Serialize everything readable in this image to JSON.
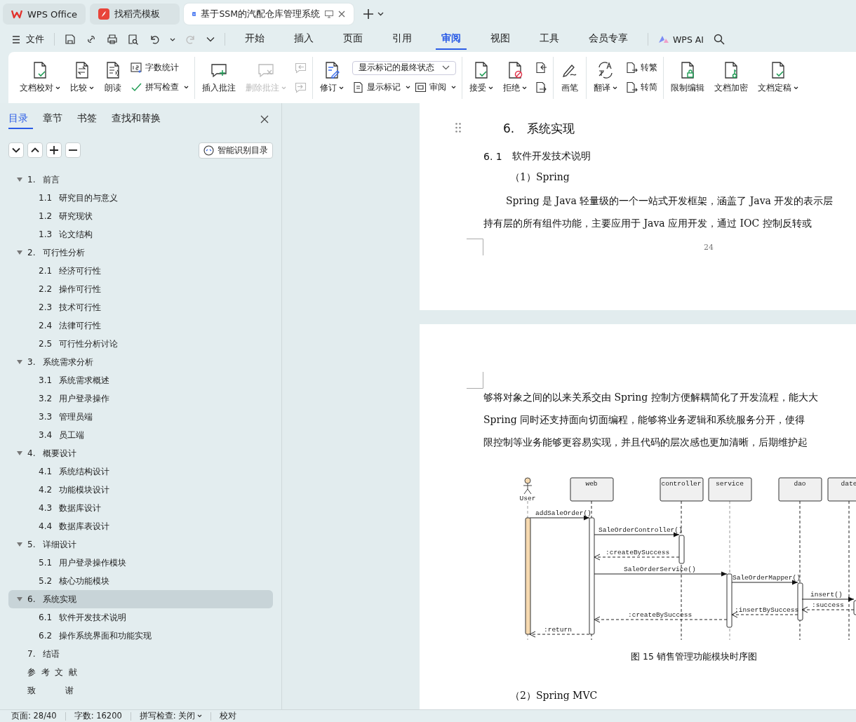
{
  "tabs": [
    {
      "label": "WPS Office",
      "kind": "home",
      "selected": false
    },
    {
      "label": "找稻壳模板",
      "kind": "template",
      "selected": false
    },
    {
      "label": "基于SSM的汽配仓库管理系统",
      "kind": "document",
      "selected": true
    }
  ],
  "menu": {
    "file_label": "文件",
    "items": [
      {
        "label": "开始",
        "selected": false
      },
      {
        "label": "插入",
        "selected": false
      },
      {
        "label": "页面",
        "selected": false
      },
      {
        "label": "引用",
        "selected": false
      },
      {
        "label": "审阅",
        "selected": true
      },
      {
        "label": "视图",
        "selected": false
      },
      {
        "label": "工具",
        "selected": false
      },
      {
        "label": "会员专享",
        "selected": false
      }
    ],
    "ai_label": "WPS AI"
  },
  "ribbon": {
    "groups": [
      {
        "tools": [
          {
            "kind": "large",
            "label": "文档校对",
            "dropdown": true,
            "disabled": false
          },
          {
            "kind": "large",
            "label": "比较",
            "dropdown": true,
            "disabled": false
          },
          {
            "kind": "large",
            "label": "朗读",
            "dropdown": false,
            "disabled": false
          },
          {
            "kind": "stack",
            "items": [
              {
                "kind": "small",
                "label": "字数统计",
                "dropdown": false,
                "disabled": false
              },
              {
                "kind": "small",
                "label": "拼写检查",
                "dropdown": true,
                "disabled": false
              }
            ]
          }
        ]
      },
      {
        "tools": [
          {
            "kind": "large",
            "label": "插入批注",
            "dropdown": false,
            "disabled": false
          },
          {
            "kind": "large",
            "label": "删除批注",
            "dropdown": true,
            "disabled": true
          },
          {
            "kind": "stack",
            "items": [
              {
                "kind": "icon",
                "disabled": true
              },
              {
                "kind": "icon",
                "disabled": true
              }
            ]
          }
        ]
      },
      {
        "tools": [
          {
            "kind": "large",
            "label": "修订",
            "dropdown": true,
            "disabled": false
          },
          {
            "kind": "stack",
            "items": [
              {
                "kind": "select",
                "value": "显示标记的最终状态"
              },
              {
                "kind": "row",
                "items": [
                  {
                    "kind": "small",
                    "label": "显示标记",
                    "dropdown": true,
                    "disabled": false
                  },
                  {
                    "kind": "small",
                    "label": "审阅",
                    "dropdown": true,
                    "disabled": false
                  }
                ]
              }
            ]
          }
        ]
      },
      {
        "tools": [
          {
            "kind": "large",
            "label": "接受",
            "dropdown": true,
            "disabled": false
          },
          {
            "kind": "large",
            "label": "拒绝",
            "dropdown": true,
            "disabled": false
          },
          {
            "kind": "stack",
            "items": [
              {
                "kind": "icon",
                "disabled": false
              },
              {
                "kind": "icon",
                "disabled": false
              }
            ]
          }
        ]
      },
      {
        "tools": [
          {
            "kind": "large",
            "label": "画笔",
            "dropdown": false,
            "disabled": false
          }
        ]
      },
      {
        "tools": [
          {
            "kind": "large",
            "label": "翻译",
            "dropdown": true,
            "disabled": false
          },
          {
            "kind": "stack",
            "items": [
              {
                "kind": "small",
                "label": "转繁",
                "dropdown": false,
                "disabled": false
              },
              {
                "kind": "small",
                "label": "转简",
                "dropdown": false,
                "disabled": false
              }
            ]
          }
        ]
      },
      {
        "tools": [
          {
            "kind": "large",
            "label": "限制编辑",
            "dropdown": false,
            "disabled": false
          },
          {
            "kind": "large",
            "label": "文档加密",
            "dropdown": false,
            "disabled": false
          },
          {
            "kind": "large",
            "label": "文档定稿",
            "dropdown": true,
            "disabled": false
          }
        ]
      }
    ]
  },
  "sidebar": {
    "tabs": [
      {
        "label": "目录",
        "selected": true
      },
      {
        "label": "章节",
        "selected": false
      },
      {
        "label": "书签",
        "selected": false
      },
      {
        "label": "查找和替换",
        "selected": false
      }
    ],
    "smart_button": "智能识别目录",
    "toc": [
      {
        "number": "1.",
        "title": "前言",
        "expanded": true,
        "selected": false,
        "children": [
          {
            "number": "1.1",
            "title": "研究目的与意义",
            "selected": false
          },
          {
            "number": "1.2",
            "title": "研究现状",
            "selected": false
          },
          {
            "number": "1.3",
            "title": "论文结构",
            "selected": false
          }
        ]
      },
      {
        "number": "2.",
        "title": "可行性分析",
        "expanded": true,
        "selected": false,
        "children": [
          {
            "number": "2.1",
            "title": "经济可行性",
            "selected": false
          },
          {
            "number": "2.2",
            "title": "操作可行性",
            "selected": false
          },
          {
            "number": "2.3",
            "title": "技术可行性",
            "selected": false
          },
          {
            "number": "2.4",
            "title": "法律可行性",
            "selected": false
          },
          {
            "number": "2.5",
            "title": "可行性分析讨论",
            "selected": false
          }
        ]
      },
      {
        "number": "3.",
        "title": "系统需求分析",
        "expanded": true,
        "selected": false,
        "children": [
          {
            "number": "3.1",
            "title": "系统需求概述",
            "selected": false
          },
          {
            "number": "3.2",
            "title": "用户登录操作",
            "selected": false
          },
          {
            "number": "3.3",
            "title": "管理员端",
            "selected": false
          },
          {
            "number": "3.4",
            "title": "员工端",
            "selected": false
          }
        ]
      },
      {
        "number": "4.",
        "title": "概要设计",
        "expanded": true,
        "selected": false,
        "children": [
          {
            "number": "4.1",
            "title": "系统结构设计",
            "selected": false
          },
          {
            "number": "4.2",
            "title": "功能模块设计",
            "selected": false
          },
          {
            "number": "4.3",
            "title": "数据库设计",
            "selected": false
          },
          {
            "number": "4.4",
            "title": "数据库表设计",
            "selected": false
          }
        ]
      },
      {
        "number": "5.",
        "title": "详细设计",
        "expanded": true,
        "selected": false,
        "children": [
          {
            "number": "5.1",
            "title": "用户登录操作模块",
            "selected": false
          },
          {
            "number": "5.2",
            "title": "核心功能模块",
            "selected": false
          }
        ]
      },
      {
        "number": "6.",
        "title": "系统实现",
        "expanded": true,
        "selected": true,
        "children": [
          {
            "number": "6.1",
            "title": "软件开发技术说明",
            "selected": false
          },
          {
            "number": "6.2",
            "title": "操作系统界面和功能实现",
            "selected": false
          }
        ]
      },
      {
        "number": "7.",
        "title": "结语",
        "selected": false
      },
      {
        "title": "参  考  文  献",
        "selected": false
      },
      {
        "title": "致           谢",
        "selected": false
      }
    ]
  },
  "document": {
    "heading": {
      "number": "6.",
      "title": "系统实现"
    },
    "subheading": {
      "number": "6. 1",
      "title": "软件开发技术说明"
    },
    "item_1": "（1）Spring",
    "paragraph_1": [
      "Spring 是 Java 轻量级的一个一站式开发框架，涵盖了 Java 开发的表示层",
      "持有层的所有组件功能，主要应用于 Java 应用开发，通过 IOC 控制反转或"
    ],
    "page_number": "24",
    "paragraph_2": [
      "够将对象之间的以来关系交由 Spring 控制方便解耦简化了开发流程，能大大",
      "Spring 同时还支持面向切面编程，能够将业务逻辑和系统服务分开，使得",
      "限控制等业务能够更容易实现，并且代码的层次感也更加清晰，后期维护起"
    ],
    "figure": {
      "participants": [
        {
          "label": "User",
          "kind": "actor"
        },
        {
          "label": "web",
          "kind": "object"
        },
        {
          "label": "controller",
          "kind": "object"
        },
        {
          "label": "service",
          "kind": "object"
        },
        {
          "label": "dao",
          "kind": "object"
        },
        {
          "label": "date",
          "kind": "object"
        }
      ],
      "messages": [
        {
          "label": "addSaleOrder()",
          "kind": "call"
        },
        {
          "label": "SaleOrderController()",
          "kind": "call"
        },
        {
          "label": ":createBySuccess",
          "kind": "return"
        },
        {
          "label": "SaleOrderService()",
          "kind": "call"
        },
        {
          "label": "SaleOrderMapper()",
          "kind": "call"
        },
        {
          "label": "insert()",
          "kind": "call"
        },
        {
          "label": ":success",
          "kind": "return"
        },
        {
          "label": ":insertBySuccess",
          "kind": "return"
        },
        {
          "label": ":createBySuccess",
          "kind": "return"
        },
        {
          "label": ":return",
          "kind": "return"
        }
      ],
      "caption": "图 15  销售管理功能模块时序图"
    },
    "item_2": "（2）Spring MVC"
  },
  "status_bar": [
    {
      "label": "页面: 28/40",
      "dropdown": false
    },
    {
      "label": "字数: 16200",
      "dropdown": false
    },
    {
      "label": "拼写检查: 关闭",
      "dropdown": true
    },
    {
      "label": "校对",
      "dropdown": false
    }
  ]
}
